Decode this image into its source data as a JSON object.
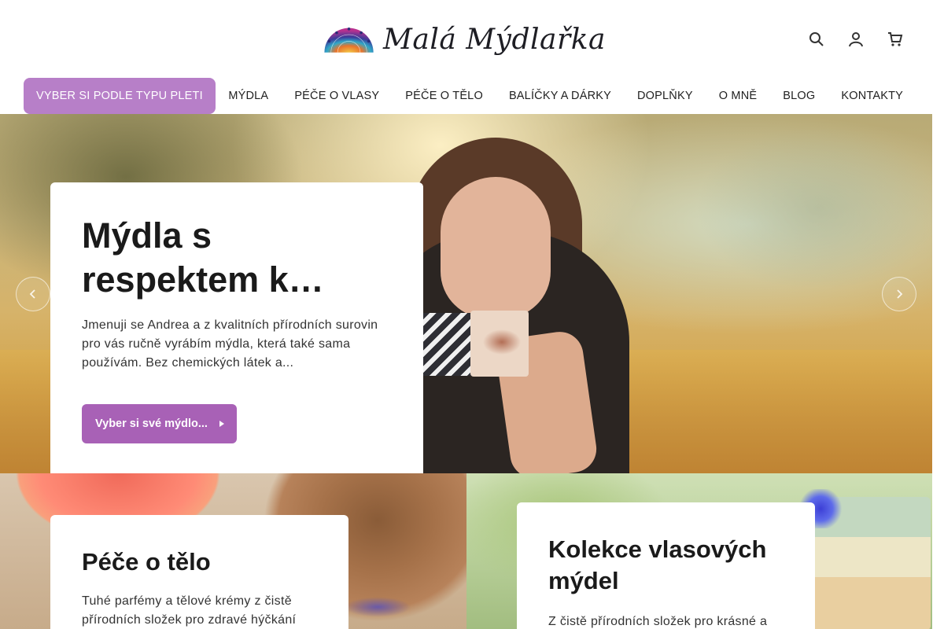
{
  "brand": {
    "name": "Malá Mýdlařka",
    "logo_icon": "mandala-logo"
  },
  "header_icons": [
    {
      "name": "search-icon"
    },
    {
      "name": "user-icon"
    },
    {
      "name": "cart-icon"
    }
  ],
  "nav": {
    "items": [
      {
        "label": "VYBER SI PODLE TYPU PLETI",
        "active": true
      },
      {
        "label": "MÝDLA"
      },
      {
        "label": "PÉČE O VLASY"
      },
      {
        "label": "PÉČE O TĚLO"
      },
      {
        "label": "BALÍČKY A DÁRKY"
      },
      {
        "label": "DOPLŇKY"
      },
      {
        "label": "O MNĚ"
      },
      {
        "label": "BLOG"
      },
      {
        "label": "KONTAKTY"
      }
    ],
    "active_color": "#b77fc8"
  },
  "hero": {
    "title": "Mýdla s respektem k…",
    "text": "Jmenuji se Andrea a z kvalitních přírodních surovin pro vás ručně vyrábím mýdla, která také sama používám. Bez chemických látek a...",
    "button_label": "Vyber si své mýdlo...",
    "button_color": "#a861b6",
    "prev_icon": "chevron-left-icon",
    "next_icon": "chevron-right-icon"
  },
  "tiles": [
    {
      "title": "Péče o tělo",
      "text": "Tuhé parfémy a tělové krémy z čistě přírodních složek pro zdravé hýčkání"
    },
    {
      "title": "Kolekce vlasových mýdel",
      "text": "Z čistě přírodních složek pro krásné a"
    }
  ]
}
